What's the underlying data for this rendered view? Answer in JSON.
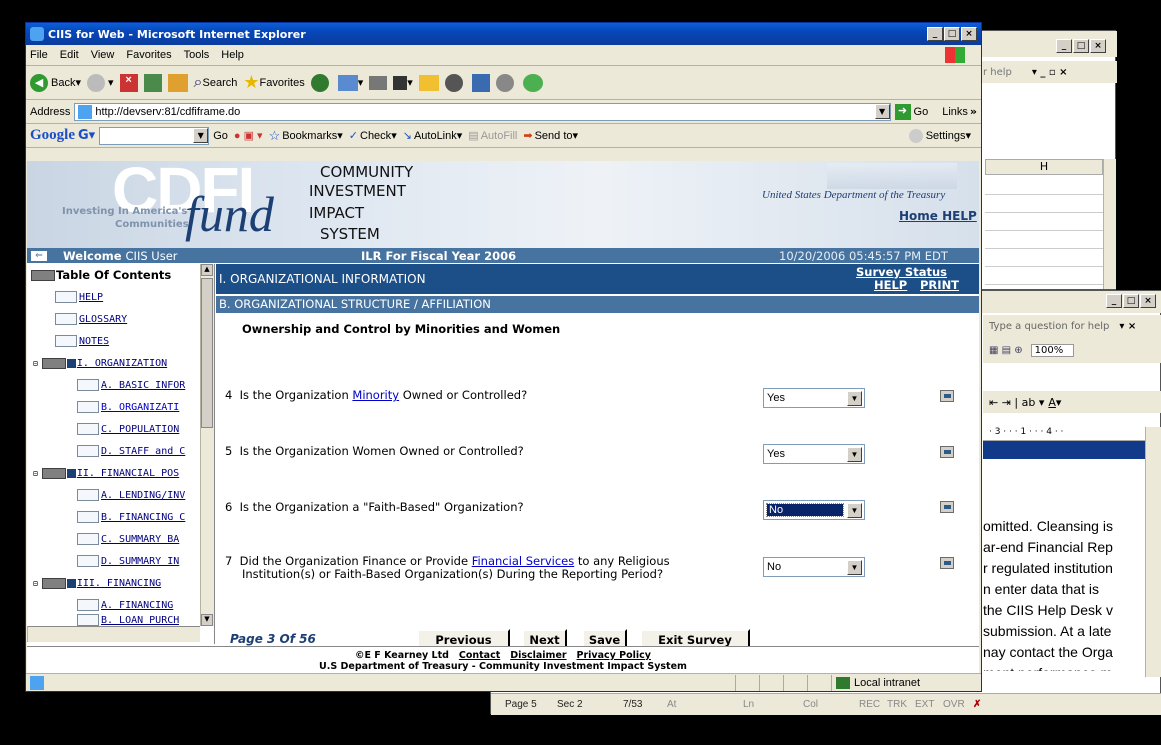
{
  "ie": {
    "title": "CIIS for Web - Microsoft Internet Explorer",
    "menu": [
      "File",
      "Edit",
      "View",
      "Favorites",
      "Tools",
      "Help"
    ],
    "toolbar": {
      "back": "Back",
      "search": "Search",
      "favorites": "Favorites"
    },
    "address_label": "Address",
    "address": "http://devserv:81/cdfiframe.do",
    "go": "Go",
    "links": "Links",
    "google": {
      "logo": "Google",
      "go": "Go",
      "bookmarks": "Bookmarks",
      "check": "Check",
      "autolink": "AutoLink",
      "autofill": "AutoFill",
      "sendto": "Send to",
      "settings": "Settings"
    },
    "status": {
      "zone": "Local intranet"
    }
  },
  "banner": {
    "logo_cdfi": "CDFI",
    "logo_fund": "fund",
    "tagline_1": "Investing In America's",
    "tagline_2": "Communities",
    "system_1": "COMMUNITY",
    "system_2": "INVESTMENT",
    "system_3": "IMPACT",
    "system_4": "SYSTEM",
    "treasury": "United States Department of the Treasury",
    "home_help": "Home HELP"
  },
  "bluebar": {
    "welcome_bold": "Welcome",
    "welcome_user": "CIIS User",
    "form_title": "ILR For Fiscal Year 2006",
    "timestamp": "10/20/2006 05:45:57 PM EDT"
  },
  "toc": {
    "title": "Table Of Contents",
    "items": [
      "HELP",
      "GLOSSARY",
      "NOTES",
      "I. ORGANIZATION",
      "A. BASIC INFOR",
      "B. ORGANIZATI",
      "C. POPULATION",
      "D. STAFF and C",
      "II. FINANCIAL POS",
      "A. LENDING/INV",
      "B. FINANCING C",
      "C. SUMMARY BA",
      "D. SUMMARY IN",
      "III. FINANCING",
      "A. FINANCING",
      "B. LOAN PURCH"
    ]
  },
  "survey": {
    "section": "I. ORGANIZATIONAL INFORMATION",
    "survey_status": "Survey Status",
    "help": "HELP",
    "print": "PRINT",
    "subsection": "B. ORGANIZATIONAL STRUCTURE / AFFILIATION",
    "heading": "Ownership and Control by Minorities and Women",
    "questions": [
      {
        "num": "4",
        "pre": "Is the Organization ",
        "link": "Minority",
        "post": " Owned or Controlled?",
        "answer": "Yes"
      },
      {
        "num": "5",
        "pre": "Is the Organization Women Owned or Controlled?",
        "link": "",
        "post": "",
        "answer": "Yes"
      },
      {
        "num": "6",
        "pre": "Is the Organization a \"Faith-Based\" Organization?",
        "link": "",
        "post": "",
        "answer": "No"
      },
      {
        "num": "7",
        "pre": "Did the Organization Finance or Provide ",
        "link": "Financial Services",
        "post": " to any Religious",
        "line2": "Institution(s) or Faith-Based Organization(s) During the Reporting Period?",
        "answer": "No"
      }
    ],
    "page": "Page 3 Of 56",
    "buttons": {
      "previous": "Previous",
      "next": "Next",
      "save": "Save",
      "exit": "Exit Survey"
    }
  },
  "footer": {
    "copyright": "©E F Kearney Ltd",
    "contact": "Contact",
    "disclaimer": "Disclaimer",
    "privacy": "Privacy Policy",
    "line2": "U.S Department of Treasury - Community Investment Impact System"
  },
  "back_window_top": {
    "help_hint": "r help",
    "col_h": "H"
  },
  "word": {
    "help_hint": "Type a question for help",
    "zoom": "100%",
    "ruler": "· 3 · · · 1 · · · 4 · ·",
    "lines": [
      "omitted. Cleansing is",
      "ar-end Financial Rep",
      "r regulated institution",
      "n enter data that is",
      "the CIIS Help Desk v",
      "submission.  At a late",
      "nay contact the Orga",
      "ment performance m"
    ],
    "status": {
      "page": "Page 5",
      "sec": "Sec 2",
      "pos": "7/53",
      "at": "At",
      "ln": "Ln",
      "col": "Col",
      "rec": "REC",
      "trk": "TRK",
      "ext": "EXT",
      "ovr": "OVR"
    }
  },
  "colors": {
    "navy": "#1c4f88",
    "bar": "#46739f",
    "link_blue": "#0000cc",
    "xp_title": "#0a50d0"
  }
}
